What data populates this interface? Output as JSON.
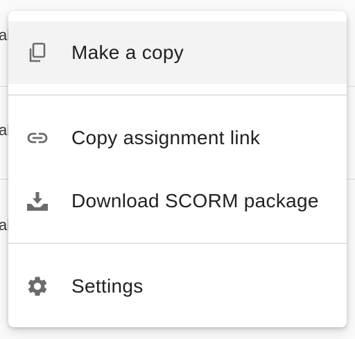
{
  "menu": {
    "items": [
      {
        "label": "Make a copy",
        "icon": "copy-icon",
        "highlighted": true
      },
      {
        "label": "Copy assignment link",
        "icon": "link-icon",
        "highlighted": false
      },
      {
        "label": "Download SCORM package",
        "icon": "download-icon",
        "highlighted": false
      },
      {
        "label": "Settings",
        "icon": "gear-icon",
        "highlighted": false
      }
    ]
  },
  "background": {
    "row_fragments": [
      "al",
      "al",
      "al"
    ]
  },
  "colors": {
    "icon": "#6b6b6b",
    "text": "#212121",
    "highlight": "#f3f3f3",
    "divider": "#e4e4e4"
  }
}
